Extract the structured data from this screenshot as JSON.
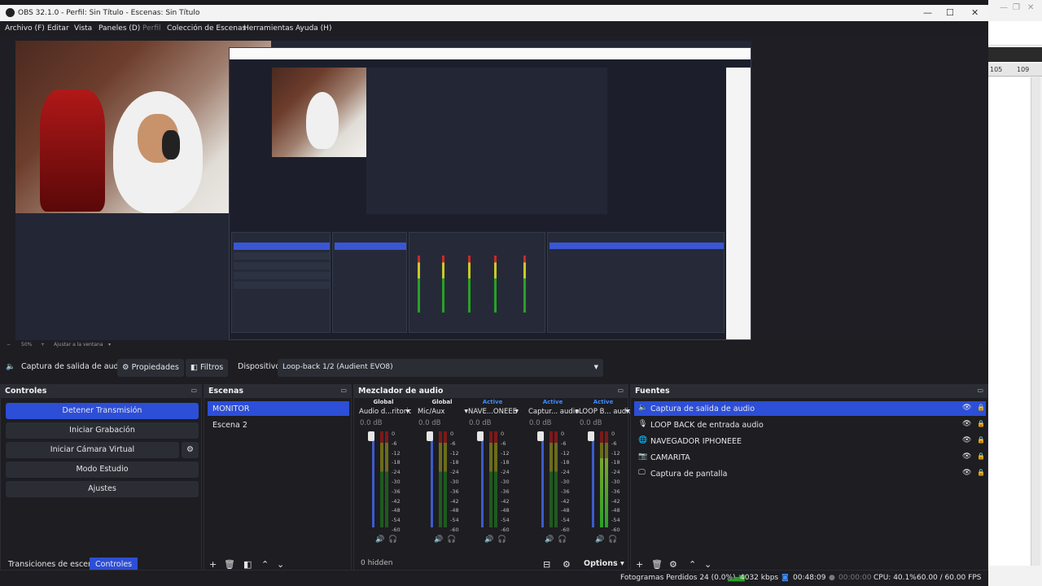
{
  "window": {
    "title": "OBS 32.1.0 - Perfil: Sin Título - Escenas: Sin Título",
    "min": "—",
    "max": "☐",
    "close": "✕"
  },
  "menu": [
    {
      "label": "Archivo (F)",
      "dim": false
    },
    {
      "label": "Editar",
      "dim": false
    },
    {
      "label": "Vista",
      "dim": false
    },
    {
      "label": "Paneles (D)",
      "dim": false
    },
    {
      "label": "Perfil",
      "dim": true
    },
    {
      "label": "Colección de Escenas",
      "dim": false
    },
    {
      "label": "Herramientas",
      "dim": false
    },
    {
      "label": "Ayuda (H)",
      "dim": false
    }
  ],
  "preview": {
    "zoom": "50%",
    "fit_label": "Ajustar a la ventana",
    "zoom_minus": "−",
    "zoom_plus": "+"
  },
  "background_app": {
    "ruler": [
      "105",
      "109"
    ]
  },
  "source_toolbar": {
    "source_name": "Captura de salida de audio",
    "properties": "Propiedades",
    "filters": "Filtros",
    "device_label": "Dispositivo",
    "device_value": "Loop-back 1/2 (Audient EVO8)"
  },
  "controls": {
    "title": "Controles",
    "buttons": {
      "stream": "Detener Transmisión",
      "record": "Iniciar Grabación",
      "virtual_cam": "Iniciar Cámara Virtual",
      "studio": "Modo Estudio",
      "settings": "Ajustes"
    },
    "tabs": {
      "transitions": "Transiciones de escena",
      "controls": "Controles"
    }
  },
  "scenes": {
    "title": "Escenas",
    "items": [
      {
        "label": "MONITOR",
        "selected": true
      },
      {
        "label": "Escena 2",
        "selected": false
      }
    ]
  },
  "mixer": {
    "title": "Mezclador de audio",
    "hidden_label": "0 hidden",
    "options_label": "Options",
    "scale": [
      "0",
      "-6",
      "-12",
      "-18",
      "-24",
      "-30",
      "-36",
      "-42",
      "-48",
      "-54",
      "-60"
    ],
    "channels": [
      {
        "monitor": "Global",
        "name": "Audio d...ritorio",
        "db": "0.0 dB",
        "level": 0.0
      },
      {
        "monitor": "Global",
        "name": "Mic/Aux",
        "db": "0.0 dB",
        "level": 0.0
      },
      {
        "monitor": "Active",
        "name": "NAVE...ONEEE",
        "db": "0.0 dB",
        "level": 0.0
      },
      {
        "monitor": "Active",
        "name": "Captur... audio",
        "db": "0.0 dB",
        "level": 0.0
      },
      {
        "monitor": "Active",
        "name": "LOOP B... audio",
        "db": "0.0 dB",
        "level": 0.72
      }
    ]
  },
  "sources": {
    "title": "Fuentes",
    "items": [
      {
        "label": "Captura de salida de audio",
        "icon": "speaker-icon",
        "selected": true
      },
      {
        "label": "LOOP BACK de entrada audio",
        "icon": "microphone-icon",
        "selected": false
      },
      {
        "label": "NAVEGADOR IPHONEEE",
        "icon": "globe-icon",
        "selected": false
      },
      {
        "label": "CAMARITA",
        "icon": "camera-icon",
        "selected": false
      },
      {
        "label": "Captura de pantalla",
        "icon": "monitor-icon",
        "selected": false
      }
    ]
  },
  "status": {
    "dropped": "Fotogramas Perdidos 24 (0.0%)",
    "bitrate": "4032 kbps",
    "stream_time": "00:48:09",
    "rec_time": "00:00:00",
    "cpu": "CPU: 40.1%",
    "fps": "60.00 / 60.00 FPS"
  },
  "colors": {
    "accent": "#2d4ed6",
    "active_monitor": "#3d8cff",
    "background": "#1d1d22",
    "panel_header": "#2b2d35"
  }
}
